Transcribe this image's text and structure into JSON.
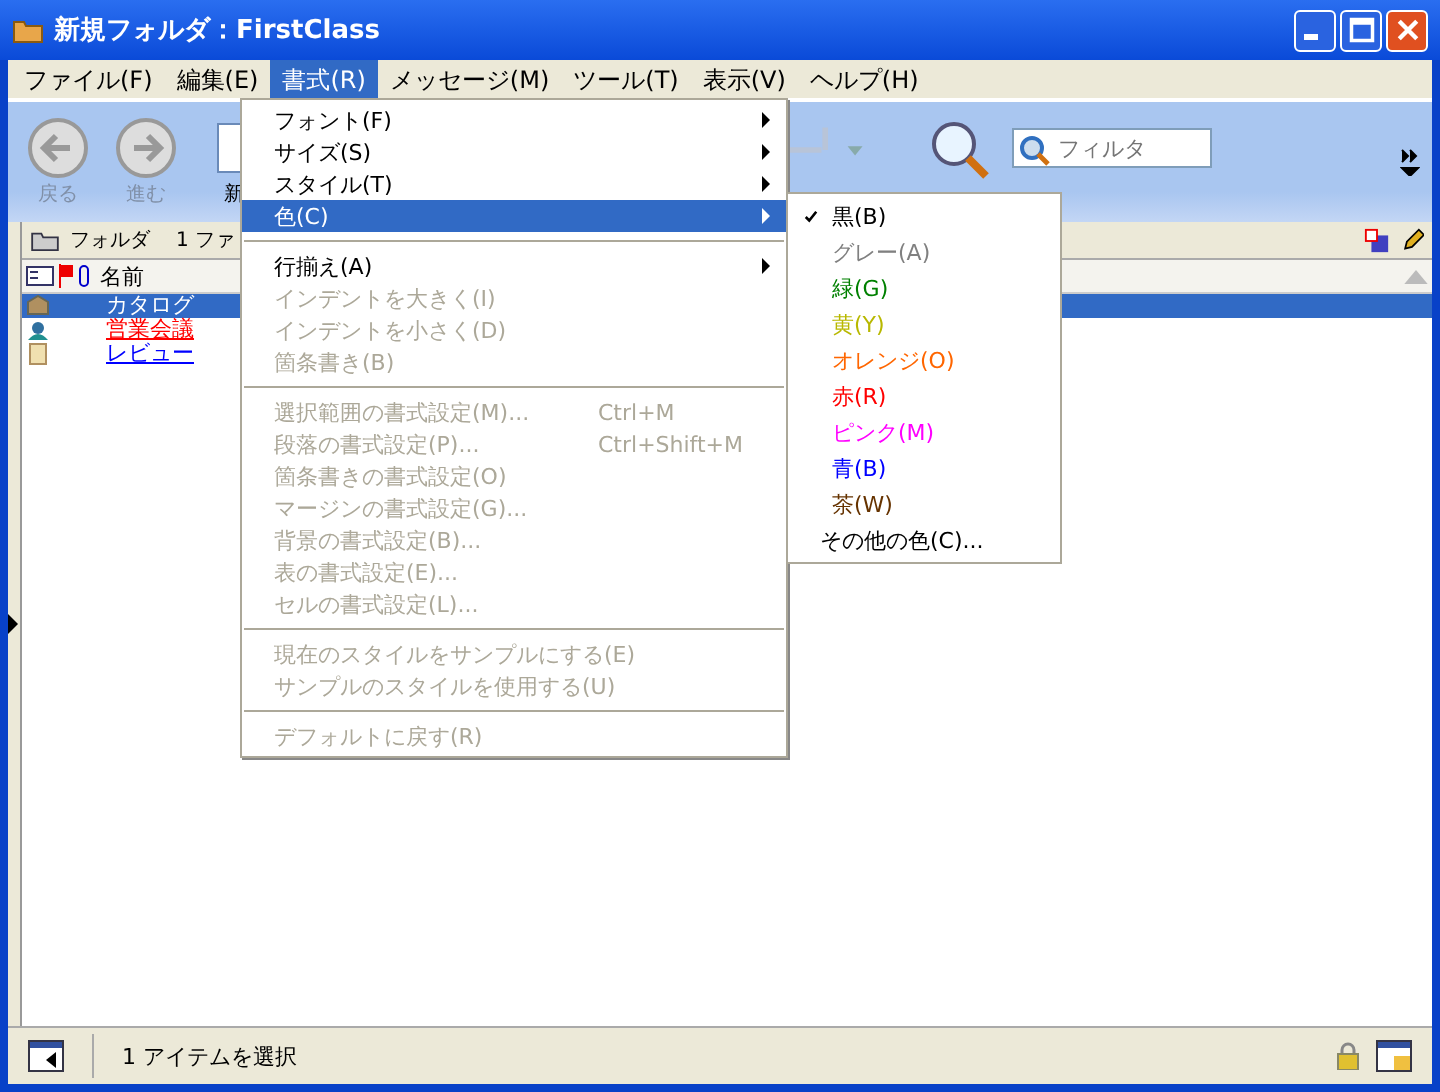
{
  "window": {
    "title": "新規フォルダ：FirstClass"
  },
  "menubar": [
    {
      "label": "ファイル(F)",
      "selected": false
    },
    {
      "label": "編集(E)",
      "selected": false
    },
    {
      "label": "書式(R)",
      "selected": true
    },
    {
      "label": "メッセージ(M)",
      "selected": false
    },
    {
      "label": "ツール(T)",
      "selected": false
    },
    {
      "label": "表示(V)",
      "selected": false
    },
    {
      "label": "ヘルプ(H)",
      "selected": false
    }
  ],
  "toolbar": [
    {
      "kind": "back",
      "label": "戻る",
      "disabled": true
    },
    {
      "kind": "forward",
      "label": "進む",
      "disabled": true
    },
    {
      "kind": "new",
      "label": "新",
      "disabled": false
    },
    {
      "kind": "reply",
      "disabled": true
    },
    {
      "kind": "search",
      "disabled": false
    }
  ],
  "filter": {
    "placeholder": "フィルタ"
  },
  "folder_bar": {
    "label": "フォルダ",
    "count": "1 ファ"
  },
  "columns": [
    {
      "label": "名前"
    }
  ],
  "rows": [
    {
      "kind": "catalog",
      "name": "カタログ",
      "selected": true
    },
    {
      "kind": "meeting",
      "name": "営業会議",
      "color": "#ff0000",
      "selected": false
    },
    {
      "kind": "document",
      "name": "レビュー",
      "color": "#0000ff",
      "selected": false
    }
  ],
  "format_menu": [
    {
      "kind": "item",
      "label": "フォント(F)",
      "submenu": true,
      "disabled": false,
      "selected": false
    },
    {
      "kind": "item",
      "label": "サイズ(S)",
      "submenu": true,
      "disabled": false,
      "selected": false
    },
    {
      "kind": "item",
      "label": "スタイル(T)",
      "submenu": true,
      "disabled": false,
      "selected": false
    },
    {
      "kind": "item",
      "label": "色(C)",
      "submenu": true,
      "disabled": false,
      "selected": true
    },
    {
      "kind": "separator"
    },
    {
      "kind": "item",
      "label": "行揃え(A)",
      "submenu": true,
      "disabled": false,
      "selected": false
    },
    {
      "kind": "item",
      "label": "インデントを大きく(I)",
      "submenu": false,
      "disabled": true,
      "selected": false
    },
    {
      "kind": "item",
      "label": "インデントを小さく(D)",
      "submenu": false,
      "disabled": true,
      "selected": false
    },
    {
      "kind": "item",
      "label": "箇条書き(B)",
      "submenu": false,
      "disabled": true,
      "selected": false
    },
    {
      "kind": "separator"
    },
    {
      "kind": "item",
      "label": "選択範囲の書式設定(M)...",
      "shortcut": "Ctrl+M",
      "submenu": false,
      "disabled": true,
      "selected": false
    },
    {
      "kind": "item",
      "label": "段落の書式設定(P)...",
      "shortcut": "Ctrl+Shift+M",
      "submenu": false,
      "disabled": true,
      "selected": false
    },
    {
      "kind": "item",
      "label": "箇条書きの書式設定(O)",
      "submenu": false,
      "disabled": true,
      "selected": false
    },
    {
      "kind": "item",
      "label": "マージンの書式設定(G)...",
      "submenu": false,
      "disabled": true,
      "selected": false
    },
    {
      "kind": "item",
      "label": "背景の書式設定(B)...",
      "submenu": false,
      "disabled": true,
      "selected": false
    },
    {
      "kind": "item",
      "label": "表の書式設定(E)...",
      "submenu": false,
      "disabled": true,
      "selected": false
    },
    {
      "kind": "item",
      "label": "セルの書式設定(L)...",
      "submenu": false,
      "disabled": true,
      "selected": false
    },
    {
      "kind": "separator"
    },
    {
      "kind": "item",
      "label": "現在のスタイルをサンプルにする(E)",
      "submenu": false,
      "disabled": true,
      "selected": false
    },
    {
      "kind": "item",
      "label": "サンプルのスタイルを使用する(U)",
      "submenu": false,
      "disabled": true,
      "selected": false
    },
    {
      "kind": "separator"
    },
    {
      "kind": "item",
      "label": "デフォルトに戻す(R)",
      "submenu": false,
      "disabled": true,
      "selected": false
    }
  ],
  "color_menu": [
    {
      "label": "黒(B)",
      "color": "#000000",
      "checked": true
    },
    {
      "label": "グレー(A)",
      "color": "#808080",
      "checked": false
    },
    {
      "label": "緑(G)",
      "color": "#008000",
      "checked": false
    },
    {
      "label": "黄(Y)",
      "color": "#b8b800",
      "checked": false
    },
    {
      "label": "オレンジ(O)",
      "color": "#ff6600",
      "checked": false
    },
    {
      "label": "赤(R)",
      "color": "#ff0000",
      "checked": false
    },
    {
      "label": "ピンク(M)",
      "color": "#ff00ff",
      "checked": false
    },
    {
      "label": "青(B)",
      "color": "#0000ff",
      "checked": false
    },
    {
      "label": "茶(W)",
      "color": "#663300",
      "checked": false
    },
    {
      "label": "その他の色(C)...",
      "color": "#000000",
      "checked": false
    }
  ],
  "status_bar": {
    "text": "1 アイテムを選択"
  }
}
